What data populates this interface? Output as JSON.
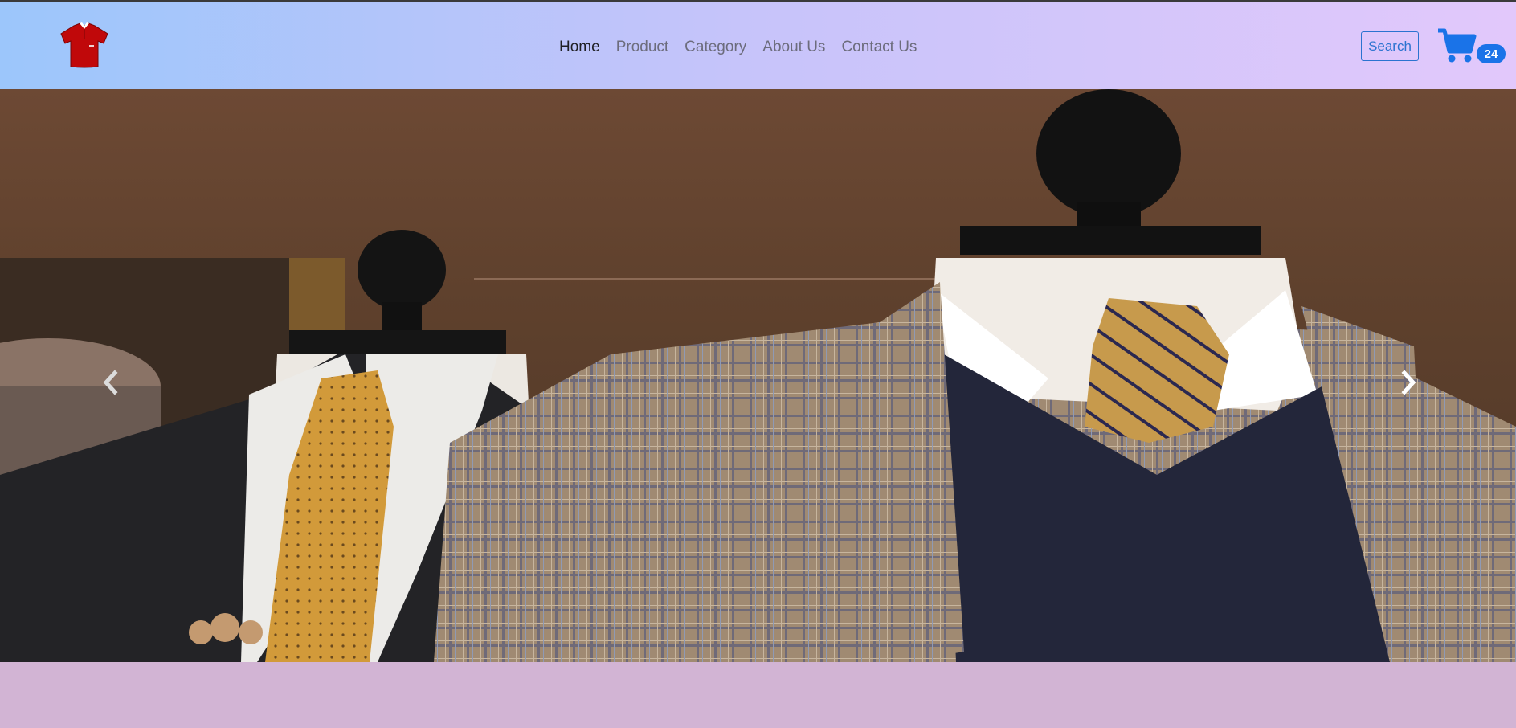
{
  "brand": {
    "logo_icon": "shirt-logo-icon",
    "logo_color": "#c0080a"
  },
  "nav": {
    "links": [
      {
        "label": "Home",
        "active": true
      },
      {
        "label": "Product",
        "active": false
      },
      {
        "label": "Category",
        "active": false
      },
      {
        "label": "About Us",
        "active": false
      },
      {
        "label": "Contact Us",
        "active": false
      }
    ]
  },
  "search": {
    "label": "Search"
  },
  "cart": {
    "icon": "cart-icon",
    "count": "24",
    "color": "#1a73e8"
  },
  "carousel": {
    "image": "menswear-mannequins-photo",
    "prev_icon": "chevron-left-icon",
    "next_icon": "chevron-right-icon"
  }
}
